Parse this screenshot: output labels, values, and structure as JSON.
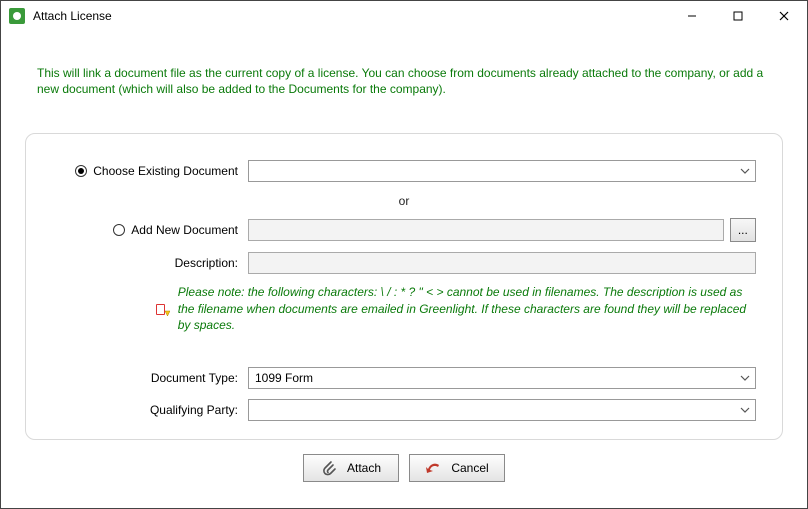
{
  "window": {
    "title": "Attach License"
  },
  "intro": "This will link a document file as the current copy of a license.  You can choose from documents already attached to the company, or add a new document (which will also be added to the Documents for the  company).",
  "form": {
    "choose_existing_label": "Choose Existing Document",
    "choose_existing_value": "",
    "or_label": "or",
    "add_new_label": "Add New Document",
    "add_new_value": "",
    "browse_label": "...",
    "description_label": "Description:",
    "description_value": "",
    "note": "Please note:  the following characters:   \\ / : * ? \" < > cannot be used in filenames.  The description is used as the filename when documents are emailed in Greenlight.  If these characters are found they will be replaced by spaces.",
    "doc_type_label": "Document Type:",
    "doc_type_value": "1099 Form",
    "qualifying_party_label": "Qualifying Party:",
    "qualifying_party_value": ""
  },
  "buttons": {
    "attach": "Attach",
    "cancel": "Cancel"
  }
}
